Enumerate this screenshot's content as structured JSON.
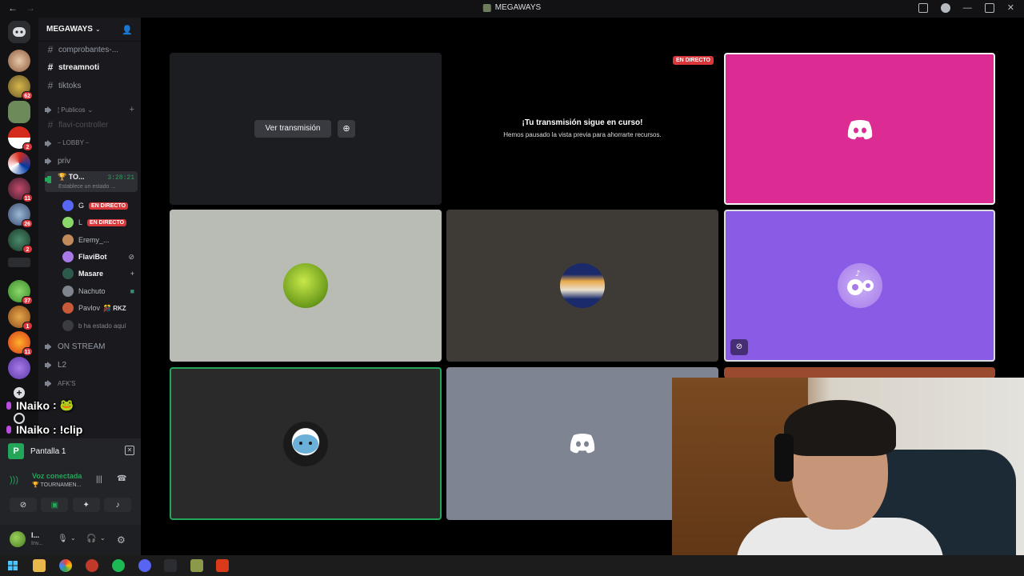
{
  "window": {
    "title": "MEGAWAYS",
    "back": "←",
    "forward": "→"
  },
  "server": {
    "name": "MEGAWAYS"
  },
  "rail": {
    "badges": [
      "62",
      "2",
      "11",
      "26",
      "2",
      "37",
      "1",
      "11"
    ]
  },
  "channels": [
    {
      "type": "text",
      "label": "comprobantes-..."
    },
    {
      "type": "text",
      "label": "streamnoti",
      "bright": true
    },
    {
      "type": "text",
      "label": "tiktoks"
    },
    {
      "type": "category",
      "label": "¦ Publicos"
    },
    {
      "type": "text",
      "label": "flavi-controller"
    },
    {
      "type": "voice",
      "label": "⎯ LOBBY ⎯"
    },
    {
      "type": "voice",
      "label": "priv"
    }
  ],
  "active_voice": {
    "label": "🏆 TO...",
    "timer": "3:28:21",
    "status": "Establece un estado ..."
  },
  "members": [
    {
      "name": "G",
      "live": "EN DIRECTO"
    },
    {
      "name": "L",
      "live": "EN DIRECTO"
    },
    {
      "name": "Eremy_..."
    },
    {
      "name": "FlaviBot"
    },
    {
      "name": "Masare"
    },
    {
      "name": "Nachuto"
    },
    {
      "name": "Pavlov",
      "tag": "🎊 RKZ"
    },
    {
      "name": "b ha estado aquí"
    }
  ],
  "more_channels": [
    {
      "label": "ON STREAM"
    },
    {
      "label": "L2"
    },
    {
      "label": "AFK'S"
    }
  ],
  "overlay_chat": [
    {
      "user": "INaiko",
      "msg": ": 🐸"
    },
    {
      "user": "INaiko",
      "msg": ": !clip"
    }
  ],
  "panel": {
    "screen_label": "Pantalla 1",
    "voice_connected": "Voz conectada",
    "voice_channel": "🏆 TOURNAMEN...",
    "username": "l...",
    "user_status": "Inv..."
  },
  "stage": {
    "watch_button": "Ver transmisión",
    "live_tag": "EN DIRECTO",
    "paused_title": "¡Tu transmisión sigue en curso!",
    "paused_desc": "Hemos pausado la vista previa para ahorrarte recursos."
  },
  "colors": {
    "live": "#da373c",
    "online": "#23a55a",
    "tile_pink": "#dd2b94",
    "tile_purple": "#8a5ce6"
  }
}
